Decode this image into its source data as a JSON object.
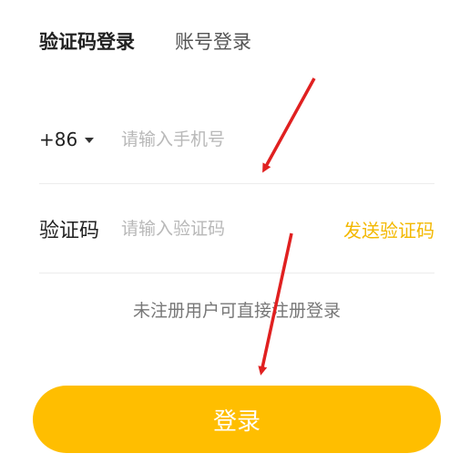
{
  "tabs": {
    "sms_login": "验证码登录",
    "account_login": "账号登录"
  },
  "phone": {
    "country_code": "+86",
    "placeholder": "请输入手机号"
  },
  "code": {
    "label": "验证码",
    "placeholder": "请输入验证码",
    "send_button": "发送验证码"
  },
  "hint": "未注册用户可直接注册登录",
  "login_button": "登录",
  "colors": {
    "accent": "#ffbe00",
    "send_text": "#f3b800",
    "arrow": "#e02020"
  }
}
